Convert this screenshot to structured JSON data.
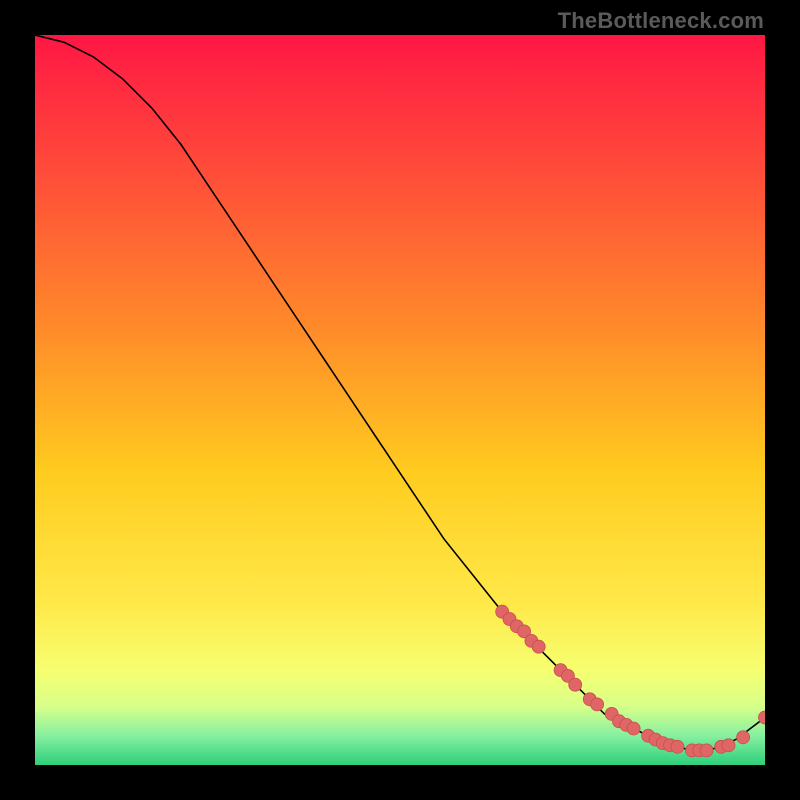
{
  "watermark": "TheBottleneck.com",
  "colors": {
    "bg": "#000000",
    "curve": "#000000",
    "marker_fill": "#e06666",
    "marker_stroke": "#c84f4f",
    "gradient_stops": [
      {
        "offset": 0.0,
        "color": "#ff1744"
      },
      {
        "offset": 0.18,
        "color": "#ff4a3a"
      },
      {
        "offset": 0.4,
        "color": "#ff8a2a"
      },
      {
        "offset": 0.6,
        "color": "#ffcc1f"
      },
      {
        "offset": 0.78,
        "color": "#ffe94a"
      },
      {
        "offset": 0.87,
        "color": "#f6ff70"
      },
      {
        "offset": 0.92,
        "color": "#d8ff8a"
      },
      {
        "offset": 0.96,
        "color": "#85f0a0"
      },
      {
        "offset": 1.0,
        "color": "#2ecf7a"
      }
    ]
  },
  "chart_data": {
    "type": "line",
    "title": "",
    "xlabel": "",
    "ylabel": "",
    "xlim": [
      0,
      100
    ],
    "ylim": [
      0,
      100
    ],
    "grid": false,
    "series": [
      {
        "name": "curve",
        "x": [
          0,
          4,
          8,
          12,
          16,
          20,
          24,
          28,
          32,
          36,
          40,
          44,
          48,
          52,
          56,
          60,
          64,
          68,
          72,
          74,
          76,
          78,
          80,
          82,
          84,
          86,
          88,
          90,
          92,
          94,
          96,
          98,
          100
        ],
        "y": [
          100,
          99,
          97,
          94,
          90,
          85,
          79,
          73,
          67,
          61,
          55,
          49,
          43,
          37,
          31,
          26,
          21,
          17,
          13,
          11,
          9,
          7,
          6,
          5,
          4,
          3,
          2.5,
          2,
          2,
          2.5,
          3.5,
          5,
          6.5
        ]
      }
    ],
    "markers": {
      "x": [
        64,
        65,
        66,
        67,
        68,
        69,
        72,
        73,
        74,
        76,
        77,
        79,
        80,
        81,
        82,
        84,
        85,
        86,
        87,
        88,
        90,
        91,
        92,
        94,
        95,
        97,
        100
      ],
      "y": [
        21,
        20,
        19,
        18.3,
        17,
        16.2,
        13,
        12.2,
        11,
        9,
        8.3,
        7,
        6,
        5.5,
        5,
        4,
        3.5,
        3,
        2.7,
        2.5,
        2,
        2,
        2,
        2.5,
        2.7,
        3.8,
        6.5
      ]
    }
  }
}
